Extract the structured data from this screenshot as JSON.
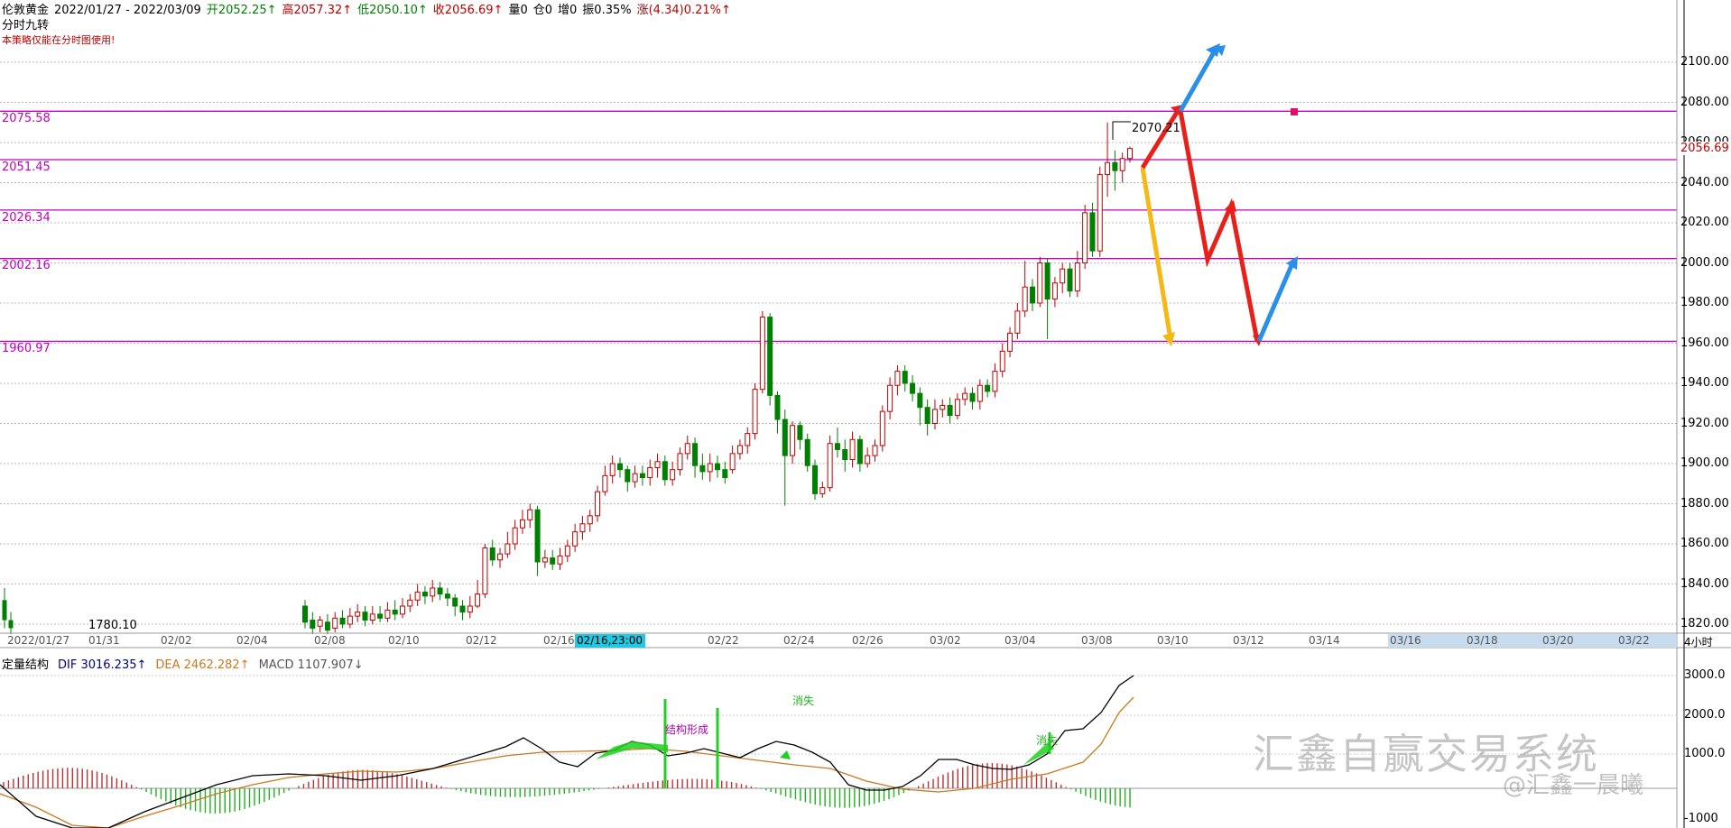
{
  "header": {
    "title": "伦敦黄金",
    "range": "2022/01/27 - 2022/03/09",
    "open": "开2052.25↑",
    "high": "高2057.32↑",
    "low": "低2050.10↑",
    "close": "收2056.69↑",
    "volume": "量0",
    "position": "仓0",
    "increase": "增0",
    "amplitude": "振0.35%",
    "change": "涨(4.34)0.21%↑",
    "line2": "分时九转",
    "line3": "本策略仅能在分时图使用!"
  },
  "levels": [
    {
      "label": "2075.58",
      "value": 2075.58
    },
    {
      "label": "2051.45",
      "value": 2051.45
    },
    {
      "label": "2026.34",
      "value": 2026.34
    },
    {
      "label": "2002.16",
      "value": 2002.16
    },
    {
      "label": "1960.97",
      "value": 1960.97
    }
  ],
  "annotations": {
    "high_label": "2070.21",
    "low_label": "1780.10",
    "current_price": "2056.69",
    "cursor_date": "02/16,23:00",
    "timeframe": "4小时"
  },
  "x_labels": [
    "2022/01/27",
    "01/31",
    "02/02",
    "02/04",
    "02/08",
    "02/10",
    "02/12",
    "02/16",
    "02/22",
    "02/24",
    "02/26",
    "03/02",
    "03/04",
    "03/08",
    "03/10",
    "03/12",
    "03/14",
    "03/16",
    "03/18",
    "03/20",
    "03/22"
  ],
  "macd": {
    "title": "定量结构",
    "dif": "DIF 3016.235↑",
    "dea": "DEA 2462.282↑",
    "macd": "MACD 1107.907↓",
    "text_structure": "结构形成",
    "text_vanish1": "消失",
    "text_vanish2": "消失",
    "y_ticks": [
      "3000.0",
      "2000.0",
      "1000.0",
      "-1000"
    ]
  },
  "watermark": {
    "main": "汇鑫自赢交易系统",
    "sub": "@汇鑫一晨曦"
  },
  "colors": {
    "up": "#c00000",
    "down": "#008000",
    "level": "#c000c0",
    "arrow_red": "#e8201a",
    "arrow_blue": "#2a8fe8",
    "arrow_yellow": "#f5b817",
    "dif": "#000000",
    "dea": "#c87a20"
  },
  "chart_data": {
    "type": "candlestick",
    "title": "伦敦黄金",
    "ylim": [
      1815,
      2115
    ],
    "y_ticks": [
      1820,
      1840,
      1860,
      1880,
      1900,
      1920,
      1940,
      1960,
      1980,
      2000,
      2020,
      2040,
      2060,
      2080,
      2100
    ],
    "candles": [
      [
        1829,
        1821,
        1832,
        1818
      ],
      [
        1822,
        1818,
        1826,
        1815
      ],
      [
        1819,
        1822,
        1824,
        1816
      ],
      [
        1821,
        1817,
        1825,
        1815
      ],
      [
        1818,
        1823,
        1826,
        1816
      ],
      [
        1823,
        1820,
        1827,
        1818
      ],
      [
        1820,
        1824,
        1828,
        1818
      ],
      [
        1824,
        1826,
        1830,
        1821
      ],
      [
        1826,
        1822,
        1829,
        1819
      ],
      [
        1822,
        1825,
        1829,
        1820
      ],
      [
        1825,
        1823,
        1829,
        1821
      ],
      [
        1823,
        1827,
        1831,
        1821
      ],
      [
        1827,
        1825,
        1832,
        1822
      ],
      [
        1825,
        1829,
        1833,
        1823
      ],
      [
        1829,
        1832,
        1835,
        1826
      ],
      [
        1832,
        1836,
        1840,
        1829
      ],
      [
        1836,
        1834,
        1839,
        1830
      ],
      [
        1834,
        1838,
        1842,
        1831
      ],
      [
        1838,
        1835,
        1841,
        1832
      ],
      [
        1835,
        1833,
        1838,
        1829
      ],
      [
        1833,
        1829,
        1835,
        1824
      ],
      [
        1829,
        1826,
        1832,
        1822
      ],
      [
        1826,
        1829,
        1834,
        1823
      ],
      [
        1829,
        1835,
        1842,
        1828
      ],
      [
        1835,
        1858,
        1860,
        1833
      ],
      [
        1858,
        1852,
        1862,
        1849
      ],
      [
        1852,
        1855,
        1858,
        1848
      ],
      [
        1855,
        1860,
        1866,
        1853
      ],
      [
        1860,
        1868,
        1872,
        1857
      ],
      [
        1868,
        1872,
        1877,
        1865
      ],
      [
        1872,
        1877,
        1880,
        1868
      ],
      [
        1877,
        1851,
        1879,
        1844
      ],
      [
        1851,
        1853,
        1857,
        1848
      ],
      [
        1853,
        1850,
        1857,
        1847
      ],
      [
        1850,
        1854,
        1858,
        1847
      ],
      [
        1854,
        1859,
        1862,
        1851
      ],
      [
        1859,
        1866,
        1870,
        1856
      ],
      [
        1866,
        1870,
        1874,
        1862
      ],
      [
        1870,
        1874,
        1877,
        1866
      ],
      [
        1874,
        1886,
        1889,
        1871
      ],
      [
        1886,
        1894,
        1899,
        1884
      ],
      [
        1894,
        1900,
        1904,
        1890
      ],
      [
        1900,
        1897,
        1903,
        1893
      ],
      [
        1897,
        1891,
        1899,
        1886
      ],
      [
        1891,
        1895,
        1899,
        1888
      ],
      [
        1895,
        1893,
        1899,
        1889
      ],
      [
        1893,
        1898,
        1902,
        1889
      ],
      [
        1898,
        1901,
        1905,
        1893
      ],
      [
        1901,
        1892,
        1904,
        1889
      ],
      [
        1892,
        1897,
        1901,
        1889
      ],
      [
        1897,
        1905,
        1908,
        1894
      ],
      [
        1905,
        1910,
        1914,
        1902
      ],
      [
        1910,
        1899,
        1913,
        1893
      ],
      [
        1899,
        1896,
        1905,
        1892
      ],
      [
        1896,
        1900,
        1905,
        1891
      ],
      [
        1900,
        1897,
        1904,
        1893
      ],
      [
        1897,
        1893,
        1901,
        1890
      ],
      [
        1897,
        1905,
        1909,
        1895
      ],
      [
        1905,
        1909,
        1912,
        1902
      ],
      [
        1909,
        1915,
        1918,
        1905
      ],
      [
        1915,
        1937,
        1940,
        1912
      ],
      [
        1937,
        1973,
        1976,
        1935
      ],
      [
        1973,
        1934,
        1975,
        1929
      ],
      [
        1934,
        1922,
        1936,
        1915
      ],
      [
        1922,
        1904,
        1927,
        1879
      ],
      [
        1904,
        1919,
        1921,
        1900
      ],
      [
        1919,
        1912,
        1921,
        1907
      ],
      [
        1912,
        1899,
        1915,
        1896
      ],
      [
        1899,
        1885,
        1902,
        1882
      ],
      [
        1885,
        1888,
        1891,
        1883
      ],
      [
        1888,
        1910,
        1914,
        1886
      ],
      [
        1910,
        1907,
        1918,
        1903
      ],
      [
        1907,
        1902,
        1912,
        1896
      ],
      [
        1902,
        1912,
        1916,
        1898
      ],
      [
        1912,
        1900,
        1914,
        1896
      ],
      [
        1900,
        1904,
        1908,
        1898
      ],
      [
        1904,
        1909,
        1912,
        1901
      ],
      [
        1909,
        1926,
        1929,
        1906
      ],
      [
        1926,
        1939,
        1943,
        1922
      ],
      [
        1939,
        1946,
        1949,
        1934
      ],
      [
        1946,
        1940,
        1949,
        1936
      ],
      [
        1940,
        1935,
        1944,
        1931
      ],
      [
        1935,
        1928,
        1938,
        1919
      ],
      [
        1928,
        1920,
        1932,
        1914
      ],
      [
        1920,
        1927,
        1932,
        1917
      ],
      [
        1927,
        1929,
        1932,
        1923
      ],
      [
        1929,
        1924,
        1933,
        1920
      ],
      [
        1924,
        1932,
        1935,
        1922
      ],
      [
        1932,
        1935,
        1938,
        1929
      ],
      [
        1935,
        1931,
        1938,
        1927
      ],
      [
        1931,
        1939,
        1942,
        1927
      ],
      [
        1939,
        1936,
        1942,
        1933
      ],
      [
        1936,
        1946,
        1950,
        1933
      ],
      [
        1946,
        1956,
        1960,
        1943
      ],
      [
        1956,
        1965,
        1968,
        1953
      ],
      [
        1965,
        1976,
        1980,
        1962
      ],
      [
        1976,
        1988,
        2001,
        1973
      ],
      [
        1988,
        1980,
        1992,
        1976
      ],
      [
        1980,
        2000,
        2003,
        1978
      ],
      [
        2000,
        1982,
        2002,
        1962
      ],
      [
        1982,
        1990,
        1993,
        1978
      ],
      [
        1990,
        1997,
        2000,
        1985
      ],
      [
        1997,
        1986,
        2000,
        1983
      ],
      [
        1986,
        2000,
        2006,
        1983
      ],
      [
        2000,
        2025,
        2029,
        1997
      ],
      [
        2025,
        2006,
        2030,
        2003
      ],
      [
        2006,
        2044,
        2048,
        2003
      ],
      [
        2044,
        2050,
        2070,
        2033
      ],
      [
        2050,
        2046,
        2056,
        2036
      ],
      [
        2046,
        2052,
        2055,
        2040
      ],
      [
        2052,
        2057,
        2058,
        2050
      ]
    ]
  }
}
